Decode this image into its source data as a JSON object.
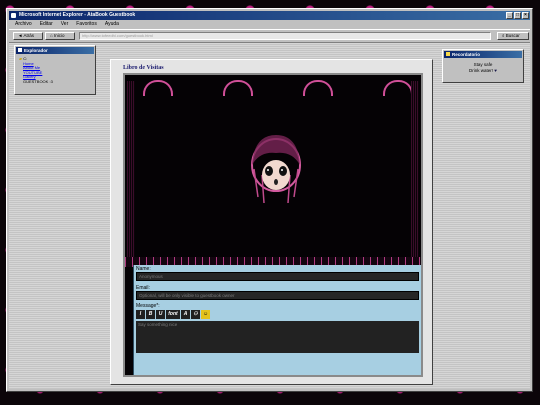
{
  "window": {
    "title": "Microsoft Internet Explorer - AtaBook Guestbook"
  },
  "menu": [
    "Archivo",
    "Editar",
    "Ver",
    "Favoritos",
    "Ayuda"
  ],
  "toolbar": {
    "back_label": "◄ Atrás",
    "home_label": "Inicio",
    "address": "http://www.tofeedhi.com/guestbook.html",
    "search_label": "Buscar"
  },
  "explorer": {
    "title": "Explorador",
    "root": "C:",
    "links": [
      "Home",
      "About Me",
      "YOUTUBE",
      "Gallery"
    ],
    "current_label": "GUESTBOOK",
    "current_suffix": ":3"
  },
  "guestbook": {
    "title": "Libro de Visitas",
    "name_label": "Name:",
    "name_value": "Anonymous",
    "email_label": "Email:",
    "email_placeholder": "Optional, will be only visible to guestbook owner",
    "message_label": "Message*:",
    "message_placeholder": "Say something nice",
    "format_buttons": [
      "I",
      "B",
      "U",
      "font",
      "A"
    ]
  },
  "reminder": {
    "title": "Recordatorio",
    "line1": "Stay safe",
    "line2": "Drink water!"
  },
  "colors": {
    "accent": "#0a246a",
    "form_bg": "#a7cfe2",
    "pink": "#d04f98"
  }
}
